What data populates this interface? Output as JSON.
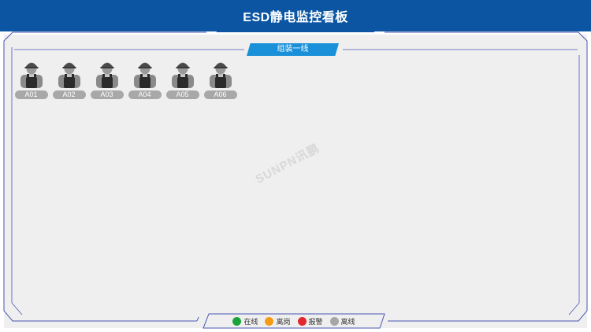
{
  "header": {
    "title": "ESD静电监控看板"
  },
  "line": {
    "label": "组装一线"
  },
  "stations": [
    {
      "label": "A01"
    },
    {
      "label": "A02"
    },
    {
      "label": "A03"
    },
    {
      "label": "A04"
    },
    {
      "label": "A05"
    },
    {
      "label": "A06"
    }
  ],
  "watermark": "SUNPN讯鹏",
  "legend": [
    {
      "label": "在线",
      "color": "#1aa33b"
    },
    {
      "label": "离岗",
      "color": "#f39c12"
    },
    {
      "label": "报警",
      "color": "#e0282e"
    },
    {
      "label": "离线",
      "color": "#a6a6a6"
    }
  ],
  "colors": {
    "header": "#0b55a3",
    "tab": "#1a90d8",
    "frame": "#4a55b3",
    "panel": "#efefef"
  }
}
